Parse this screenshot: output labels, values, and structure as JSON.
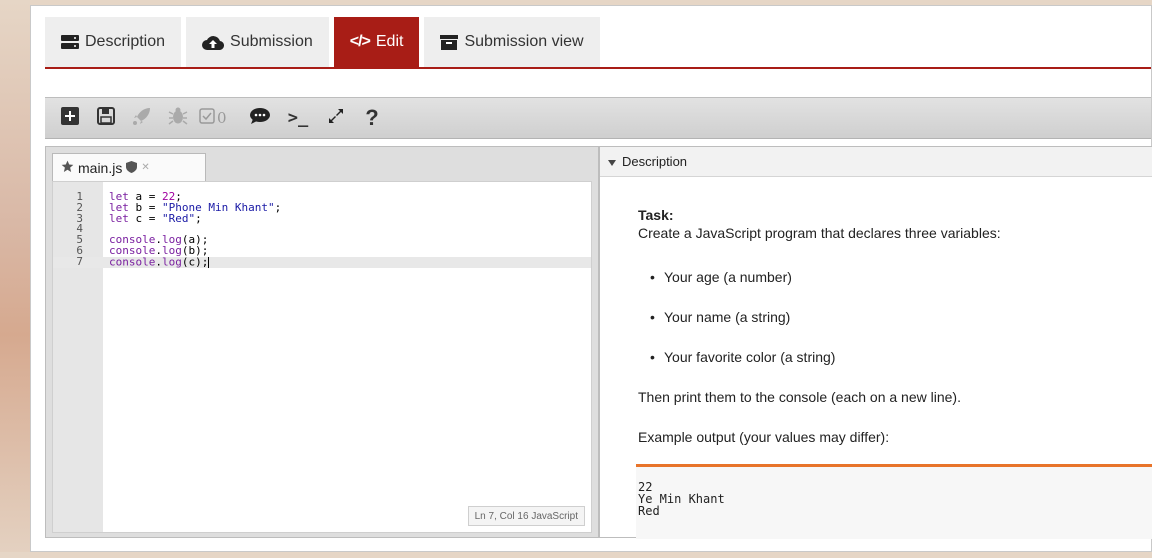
{
  "tabs": [
    {
      "label": "Description",
      "icon": "server-icon",
      "active": false
    },
    {
      "label": "Submission",
      "icon": "cloud-upload-icon",
      "active": false
    },
    {
      "label": "Edit",
      "icon": "code-icon",
      "active": true
    },
    {
      "label": "Submission view",
      "icon": "archive-icon",
      "active": false
    }
  ],
  "toolbar": {
    "buttons": [
      "new-file-icon",
      "save-icon",
      "rocket-icon",
      "bug-icon",
      "checkbox-icon",
      "comment-icon",
      "terminal-icon",
      "expand-icon",
      "help-icon"
    ],
    "check_count": "0",
    "terminal_glyph": ">_",
    "help_glyph": "?"
  },
  "editor": {
    "file_name": "main.js",
    "lines": [
      {
        "n": "1",
        "code": "let a = 22;"
      },
      {
        "n": "2",
        "code": "let b = \"Phone Min Khant\";"
      },
      {
        "n": "3",
        "code": "let c = \"Red\";"
      },
      {
        "n": "4",
        "code": ""
      },
      {
        "n": "5",
        "code": "console.log(a);"
      },
      {
        "n": "6",
        "code": "console.log(b);"
      },
      {
        "n": "7",
        "code": "console.log(c);"
      }
    ],
    "status": "Ln 7, Col 16 JavaScript"
  },
  "description": {
    "header": "Description",
    "task_title": "Task:",
    "task_text": "Create a JavaScript program that declares three variables:",
    "items": [
      "Your age (a number)",
      "Your name (a string)",
      "Your favorite color (a string)"
    ],
    "print_text": "Then print them to the console (each on a new line).",
    "example_text": "Example output (your values may differ):",
    "output": [
      "22",
      "Ye Min Khant",
      "Red"
    ]
  },
  "colors": {
    "accent": "#a81d16",
    "output_border": "#e8742a"
  }
}
